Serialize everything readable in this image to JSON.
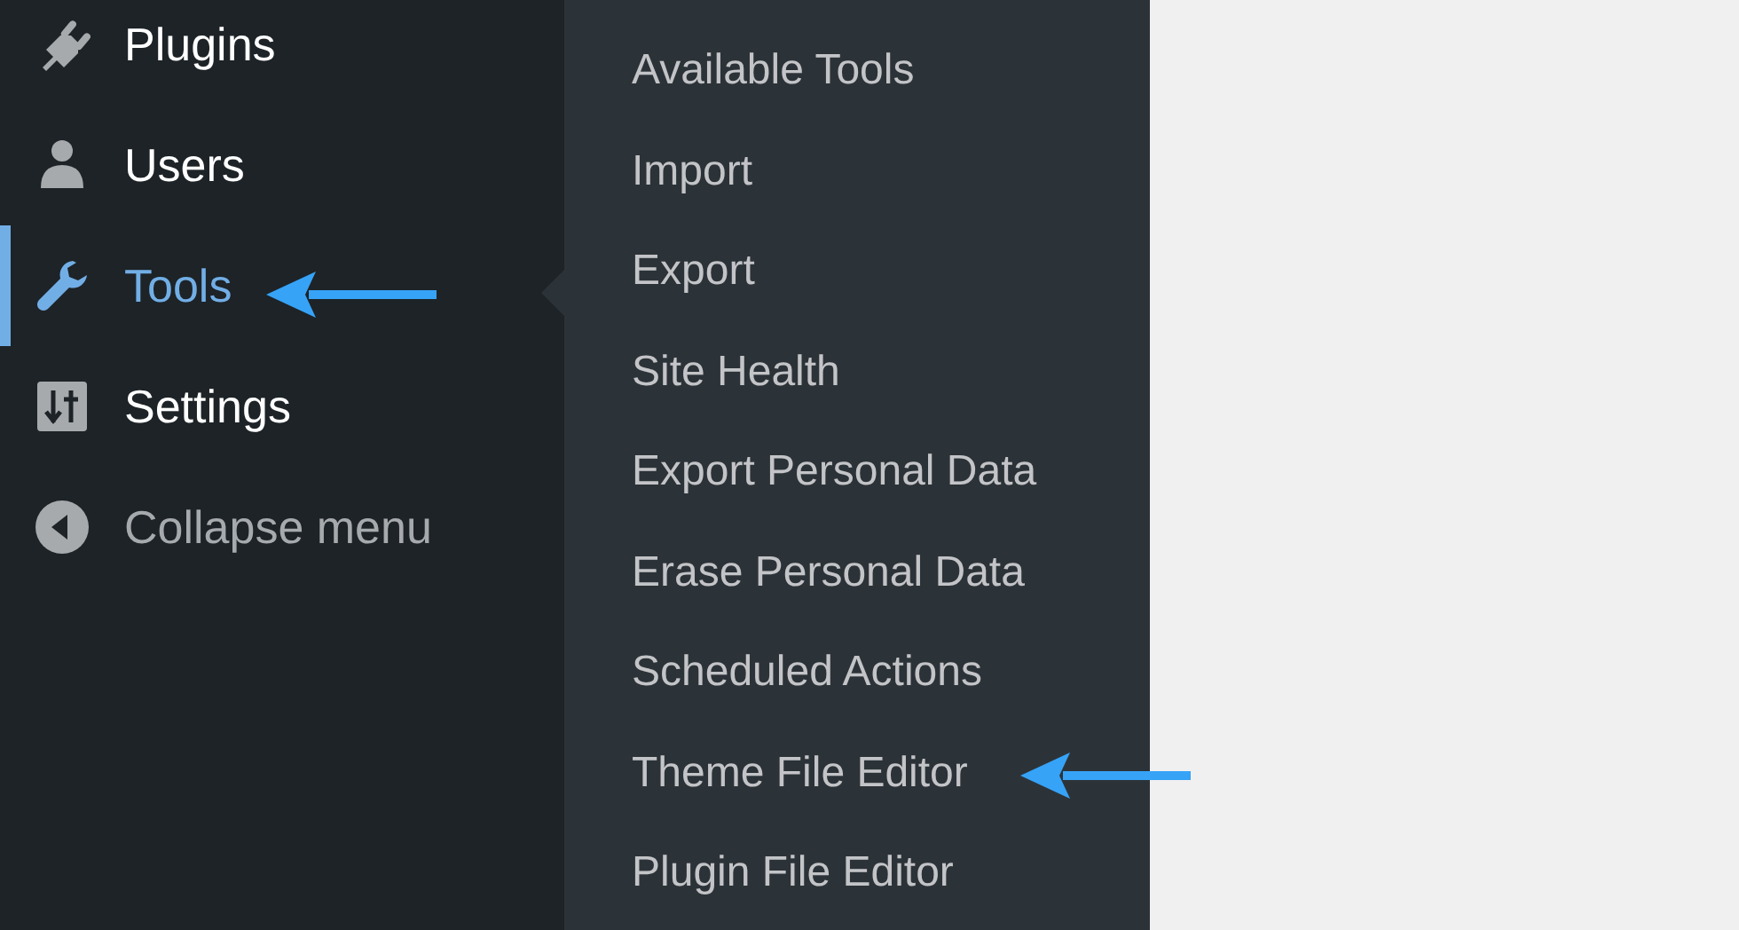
{
  "sidebar": {
    "items": [
      {
        "label": "Plugins",
        "kind": "link",
        "selected": false,
        "arrow": false
      },
      {
        "label": "Users",
        "kind": "link",
        "selected": false,
        "arrow": false
      },
      {
        "label": "Tools",
        "kind": "link",
        "selected": true,
        "arrow": true
      },
      {
        "label": "Settings",
        "kind": "link",
        "selected": false,
        "arrow": false
      },
      {
        "label": "Collapse menu",
        "kind": "collapse",
        "selected": false,
        "arrow": false
      }
    ]
  },
  "submenu": {
    "items": [
      {
        "label": "Available Tools",
        "arrow": false
      },
      {
        "label": "Import",
        "arrow": false
      },
      {
        "label": "Export",
        "arrow": false
      },
      {
        "label": "Site Health",
        "arrow": false
      },
      {
        "label": "Export Personal Data",
        "arrow": false
      },
      {
        "label": "Erase Personal Data",
        "arrow": false
      },
      {
        "label": "Scheduled Actions",
        "arrow": false
      },
      {
        "label": "Theme File Editor",
        "arrow": true
      },
      {
        "label": "Plugin File Editor",
        "arrow": false
      }
    ]
  }
}
